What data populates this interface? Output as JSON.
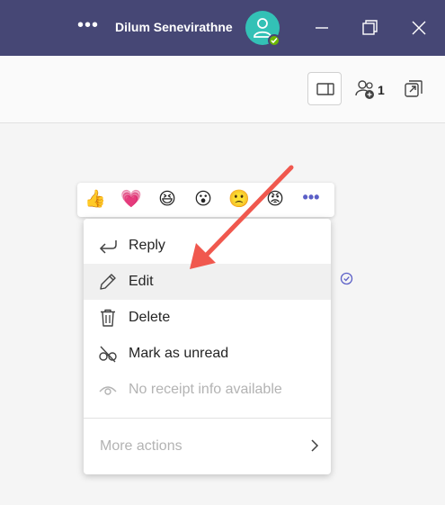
{
  "titlebar": {
    "more_label": "•••",
    "user_name": "Dilum Senevirathne",
    "avatar_icon": "person-icon",
    "presence_icon": "available-check-icon",
    "window_buttons": [
      "minimize-icon",
      "restore-icon",
      "close-icon"
    ]
  },
  "header": {
    "people_count": "1",
    "icons": [
      "side-panel-icon",
      "people-add-icon",
      "popout-icon"
    ]
  },
  "reactions": {
    "items": [
      {
        "name": "like",
        "glyph": "👍"
      },
      {
        "name": "heart",
        "glyph": "💗"
      },
      {
        "name": "laugh",
        "glyph": "😆"
      },
      {
        "name": "surprised",
        "glyph": "😮"
      },
      {
        "name": "sad",
        "glyph": "🙁"
      },
      {
        "name": "angry",
        "glyph": "😡"
      }
    ],
    "more_label": "•••"
  },
  "menu": {
    "items": [
      {
        "label": "Reply",
        "icon": "reply-icon",
        "disabled": false
      },
      {
        "label": "Edit",
        "icon": "pencil-icon",
        "disabled": false
      },
      {
        "label": "Delete",
        "icon": "trash-icon",
        "disabled": false
      },
      {
        "label": "Mark as unread",
        "icon": "eye-off-icon",
        "disabled": true
      },
      {
        "label": "No receipt info available",
        "icon": "eye-icon",
        "disabled": true
      }
    ],
    "more_actions_label": "More actions"
  },
  "colors": {
    "titlebar": "#464775",
    "accent": "#5b5fc7",
    "annotation_arrow": "#f0584e",
    "presence": "#6bb700"
  }
}
